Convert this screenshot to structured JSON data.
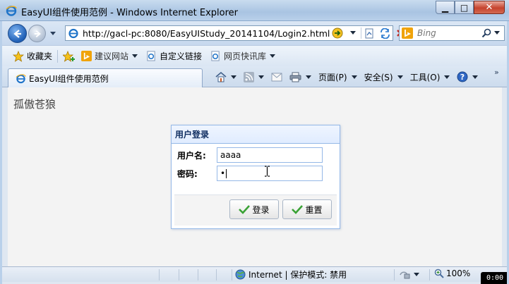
{
  "window": {
    "title": "EasyUI组件使用范例 - Windows Internet Explorer",
    "min_label": "▁",
    "max_label": "□",
    "close_label": "✕"
  },
  "address": {
    "url": "http://gacl-pc:8080/EasyUIStudy_20141104/Login2.html"
  },
  "search": {
    "placeholder": "Bing"
  },
  "favorites": {
    "favorites_label": "收藏夹",
    "suggested_sites": "建议网站",
    "custom_links": "自定义链接",
    "web_slice_gallery": "网页快讯库"
  },
  "tab": {
    "label": "EasyUI组件使用范例"
  },
  "commands": {
    "page": "页面(P)",
    "safety": "安全(S)",
    "tools": "工具(O)"
  },
  "page": {
    "brand": "孤傲苍狼",
    "login": {
      "title": "用户登录",
      "username_label": "用户名:",
      "username_value": "aaaa",
      "password_label": "密码:",
      "password_value": "•",
      "login_button": "登录",
      "reset_button": "重置"
    }
  },
  "status": {
    "zone": "Internet | 保护模式: 禁用",
    "zoom": "100%"
  },
  "recorder": {
    "timer": "0:00"
  },
  "colors": {
    "panel_border": "#95b8e7",
    "panel_header": "#e0ecff",
    "ok_green": "#3aa235"
  }
}
